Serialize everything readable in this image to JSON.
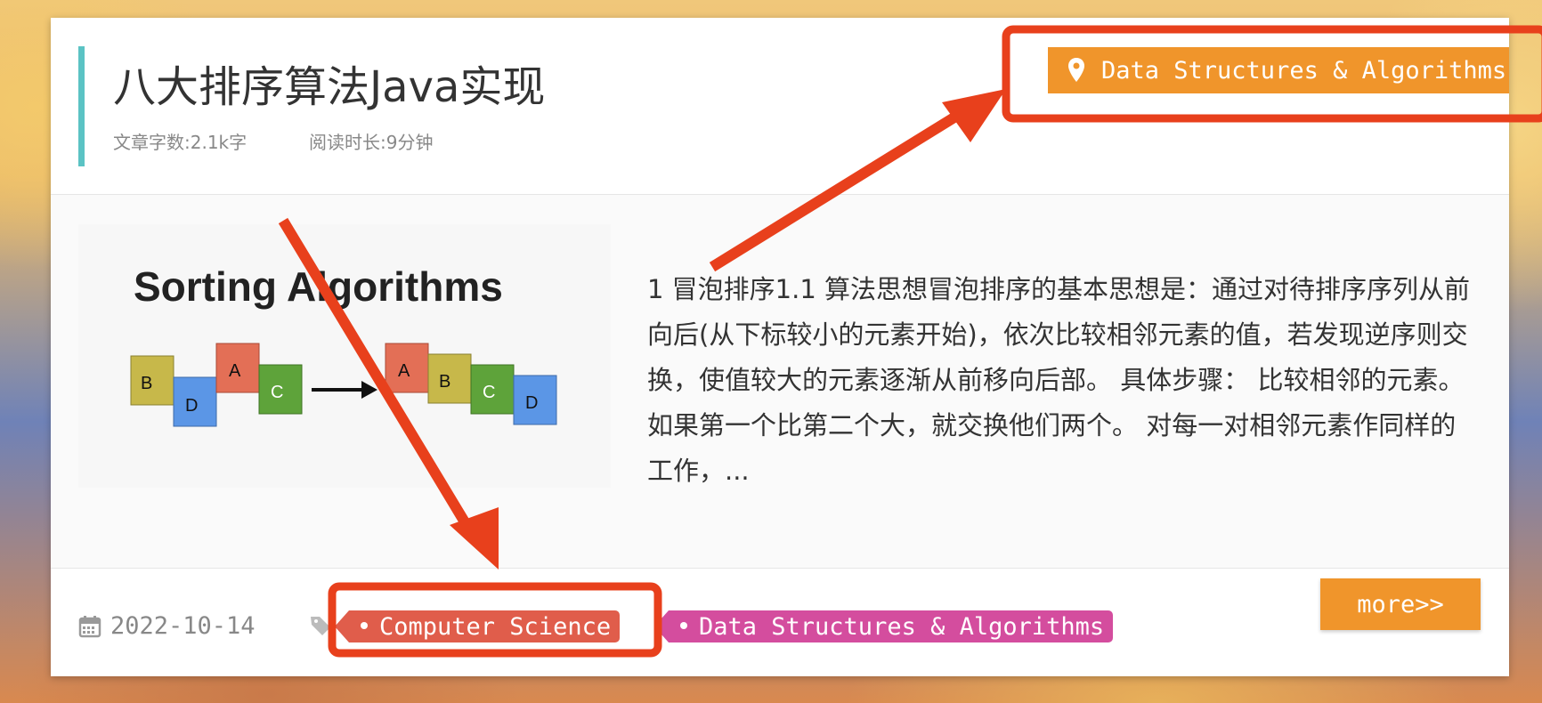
{
  "post": {
    "title": "八大排序算法Java实现",
    "word_count": "文章字数:2.1k字",
    "read_time": "阅读时长:9分钟",
    "category": "Data Structures & Algorithms",
    "excerpt": "1 冒泡排序1.1 算法思想冒泡排序的基本思想是：通过对待排序序列从前向后(从下标较小的元素开始)，依次比较相邻元素的值，若发现逆序则交换，使值较大的元素逐渐从前移向后部。 具体步骤： 比较相邻的元素。如果第一个比第二个大，就交换他们两个。 对每一对相邻元素作同样的工作，...",
    "date": "2022-10-14",
    "tags": [
      "Computer Science",
      "Data Structures & Algorithms"
    ],
    "more_label": "more>>"
  },
  "thumbnail": {
    "heading": "Sorting Algorithms",
    "before": [
      "B",
      "D",
      "A",
      "C"
    ],
    "after": [
      "A",
      "B",
      "C",
      "D"
    ]
  },
  "colors": {
    "accent_teal": "#5bc3c4",
    "accent_orange": "#f0952b",
    "tag_cs": "#e05d4b",
    "tag_dsa": "#d44d9e",
    "annotation_red": "#e8401c",
    "block_A": "#e36f56",
    "block_B": "#c7b84a",
    "block_C": "#5ea33a",
    "block_D": "#5b96e6"
  }
}
